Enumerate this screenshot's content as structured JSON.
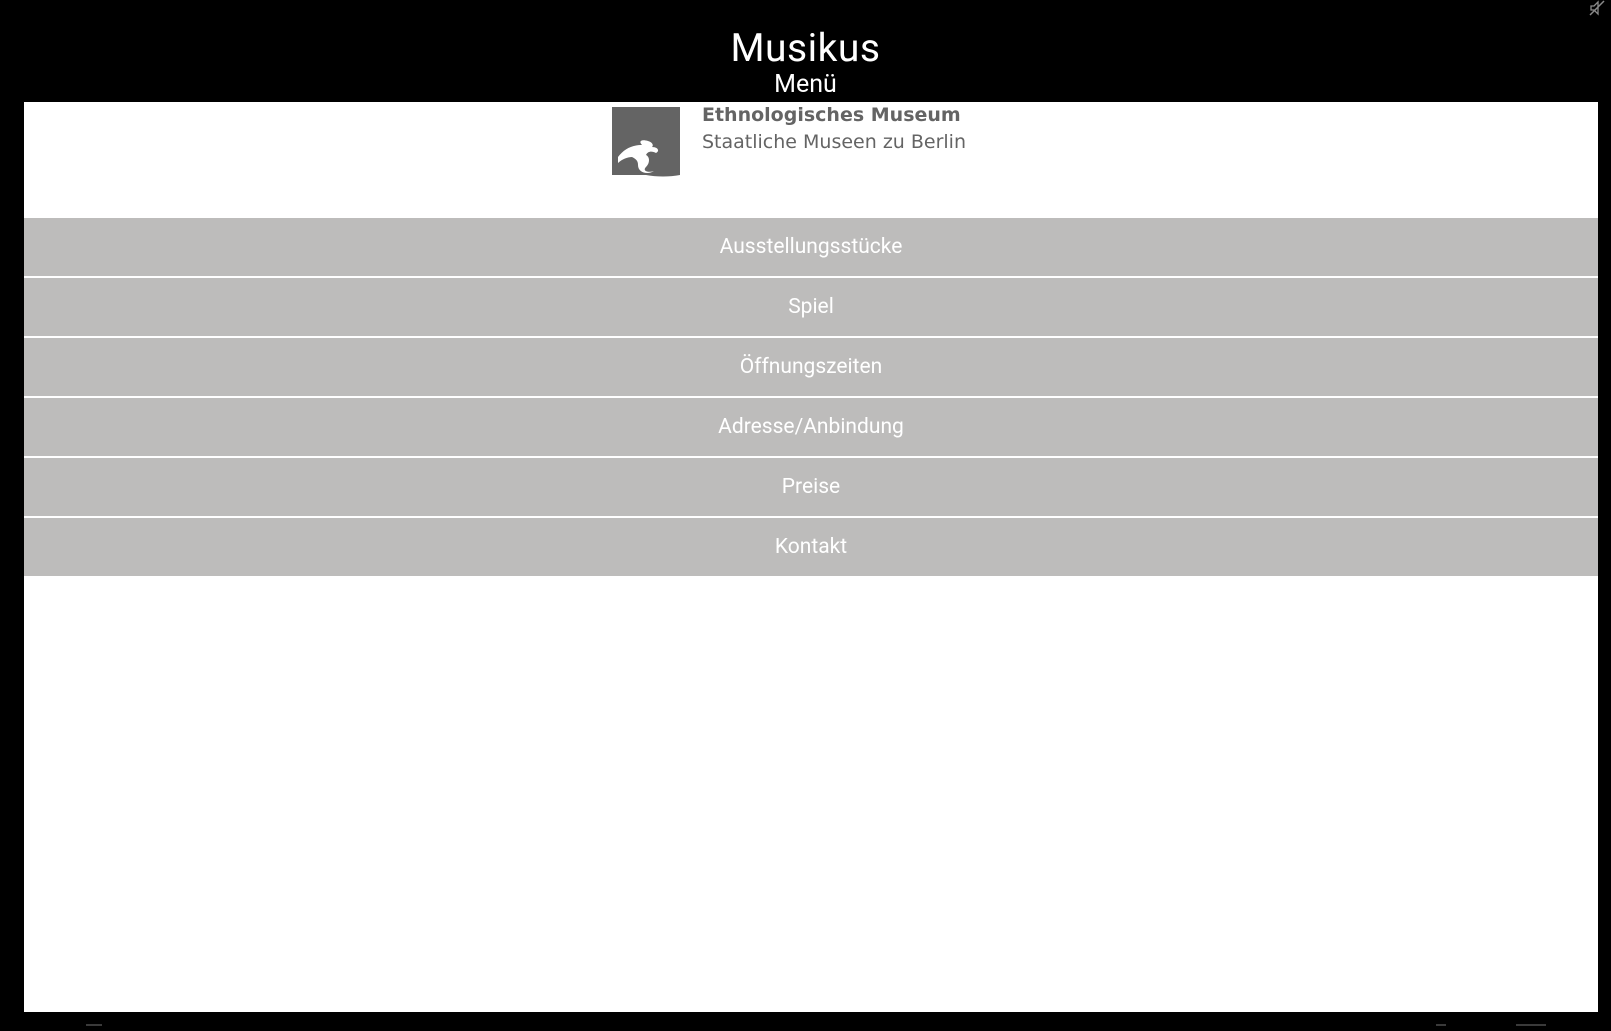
{
  "header": {
    "title": "Musikus",
    "subtitle": "Menü"
  },
  "logo": {
    "name": "Ethnologisches Museum",
    "institution": "Staatliche Museen zu Berlin",
    "icon": "eagle-logo-icon"
  },
  "menu": {
    "items": [
      {
        "label": "Ausstellungsstücke"
      },
      {
        "label": "Spiel"
      },
      {
        "label": "Öffnungszeiten"
      },
      {
        "label": "Adresse/Anbindung"
      },
      {
        "label": "Preise"
      },
      {
        "label": "Kontakt"
      }
    ]
  },
  "status_bar": {
    "icon": "mute-icon"
  },
  "colors": {
    "background": "#000000",
    "panel": "#ffffff",
    "menu_item": "#bdbcbb",
    "menu_text": "#ffffff",
    "logo_text": "#646464"
  }
}
